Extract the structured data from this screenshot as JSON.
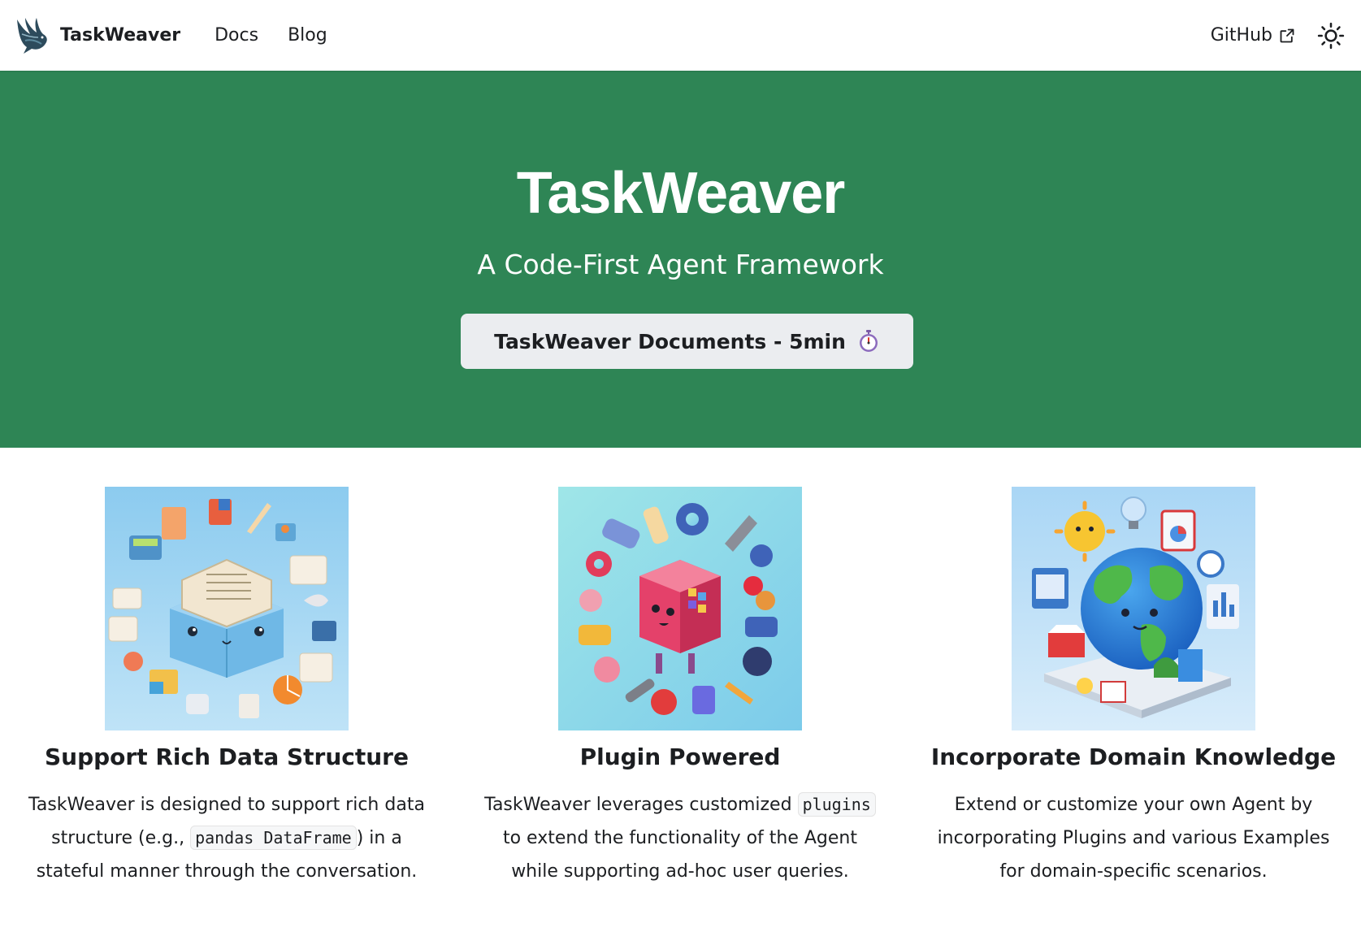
{
  "navbar": {
    "brand": "TaskWeaver",
    "links": [
      "Docs",
      "Blog"
    ],
    "github_label": "GitHub"
  },
  "icons": {
    "logo": "bird-logo-icon",
    "external": "external-link-icon",
    "theme": "sun-icon",
    "timer": "stopwatch-icon"
  },
  "hero": {
    "title": "TaskWeaver",
    "subtitle": "A Code-First Agent Framework",
    "button_label": "TaskWeaver Documents - 5min",
    "background_color": "#2e8555"
  },
  "features": [
    {
      "title": "Support Rich Data Structure",
      "desc_before": "TaskWeaver is designed to support rich data structure (e.g., ",
      "code": "pandas DataFrame",
      "desc_after": ") in a stateful manner through the conversation."
    },
    {
      "title": "Plugin Powered",
      "desc_before": "TaskWeaver leverages customized ",
      "code": "plugins",
      "desc_after": " to extend the functionality of the Agent while supporting ad-hoc user queries."
    },
    {
      "title": "Incorporate Domain Knowledge",
      "desc_before": "Extend or customize your own Agent by incorporating Plugins and various Examples for domain-specific scenarios.",
      "code": "",
      "desc_after": ""
    }
  ]
}
